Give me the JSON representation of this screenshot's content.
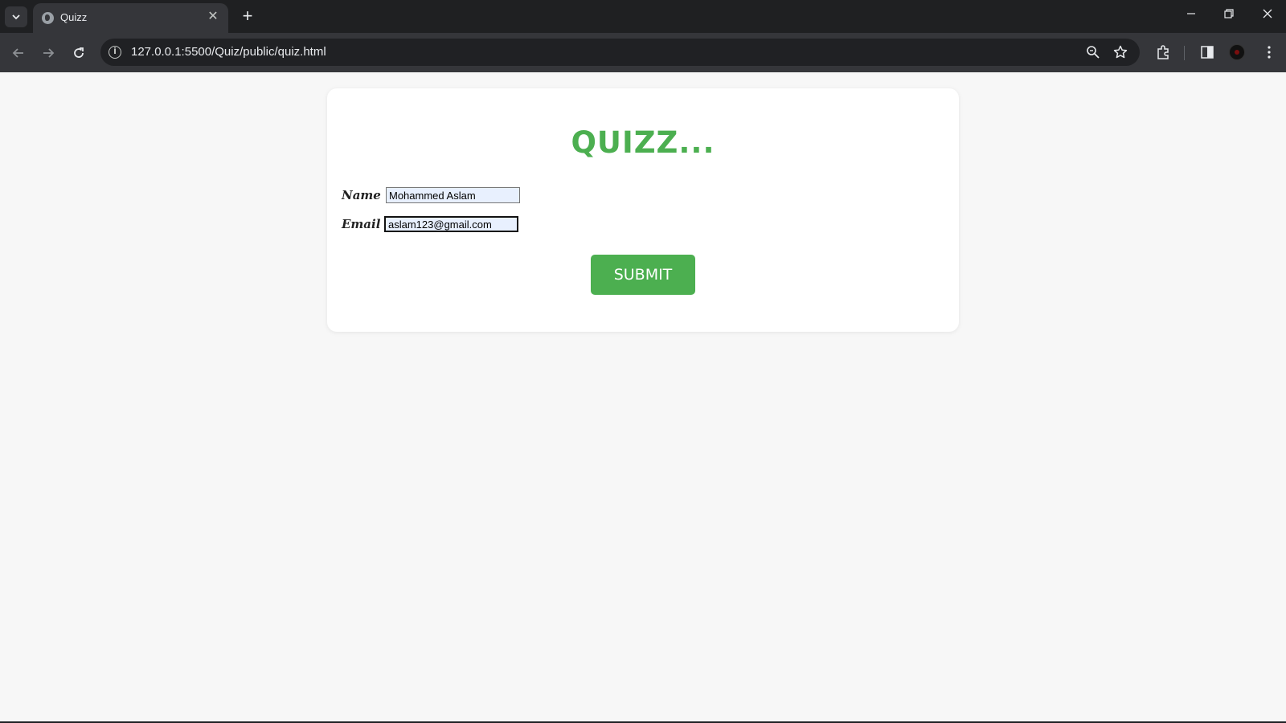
{
  "browser": {
    "tab_title": "Quizz",
    "url": "127.0.0.1:5500/Quiz/public/quiz.html"
  },
  "page": {
    "title": "QUIZZ...",
    "name_label": "Name :",
    "name_value": "Mohammed Aslam",
    "email_label": "Email :",
    "email_value": "aslam123@gmail.com",
    "submit_label": "SUBMIT"
  },
  "colors": {
    "accent": "#4caf50",
    "page_background": "#f7f7f7",
    "chrome_dark": "#1f2022"
  },
  "icons": [
    "tab-search-icon",
    "globe-icon",
    "close-icon",
    "plus-icon",
    "minimize-icon",
    "restore-icon",
    "window-close-icon",
    "back-arrow-icon",
    "forward-arrow-icon",
    "reload-icon",
    "info-icon",
    "zoom-icon",
    "star-icon",
    "extensions-icon",
    "side-panel-icon",
    "avatar",
    "kebab-menu-icon"
  ]
}
